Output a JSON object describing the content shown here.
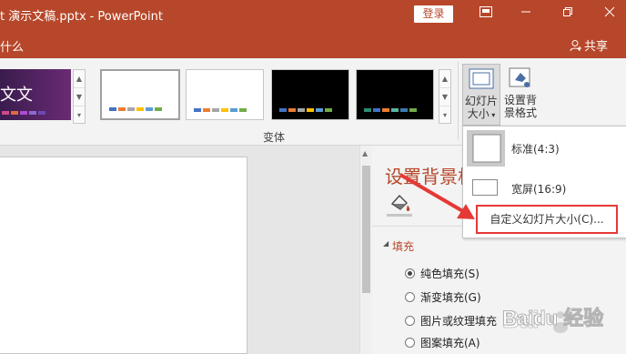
{
  "titlebar": {
    "filename": "t 演示文稿.pptx",
    "separator": "-",
    "app_name": "PowerPoint",
    "login_label": "登录",
    "bg_color": "#b7472a"
  },
  "ribbon_tabs": {
    "tell_me": "什么",
    "share_label": "共享"
  },
  "ribbon": {
    "first_theme_text": "文文",
    "group_label": "变体",
    "slide_size_label_line1": "幻灯片",
    "slide_size_label_line2": "大小",
    "format_bg_label_line1": "设置背",
    "format_bg_label_line2": "景格式"
  },
  "slide_size_menu": {
    "standard_label": "标准(4:3)",
    "widescreen_label": "宽屏(16:9)",
    "custom_label": "自定义幻灯片大小(C)..."
  },
  "format_pane": {
    "title": "设置背景格",
    "fill_section": "填充",
    "options": [
      {
        "label": "纯色填充(S)",
        "selected": true
      },
      {
        "label": "渐变填充(G)",
        "selected": false
      },
      {
        "label": "图片或纹理填充",
        "selected": false
      },
      {
        "label": "图案填充(A)",
        "selected": false
      }
    ]
  },
  "watermark": {
    "text": "Baidu 经验"
  },
  "colors": {
    "accent": "#b7472a",
    "annotation_red": "#e53935"
  }
}
